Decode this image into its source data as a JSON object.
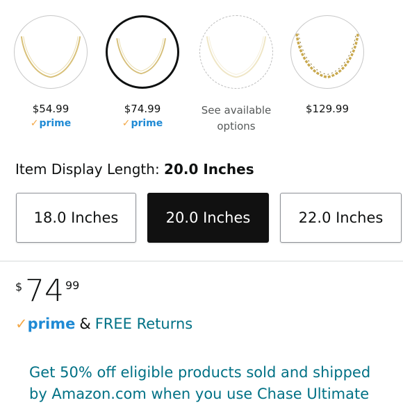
{
  "variants": [
    {
      "price": "$54.99",
      "prime": true,
      "state": "default"
    },
    {
      "price": "$74.99",
      "prime": true,
      "state": "selected"
    },
    {
      "note_line1": "See available",
      "note_line2": "options",
      "prime": false,
      "state": "unavailable"
    },
    {
      "price": "$129.99",
      "prime": false,
      "state": "default"
    }
  ],
  "prime_label": "prime",
  "length_selector": {
    "label": "Item Display Length:",
    "selected_value": "20.0 Inches",
    "options": [
      "18.0 Inches",
      "20.0 Inches",
      "22.0 Inches"
    ]
  },
  "price": {
    "symbol": "$",
    "whole": "74",
    "fraction": "99"
  },
  "shipping": {
    "prime": "prime",
    "connector": "&",
    "returns": "FREE Returns"
  },
  "promo": {
    "line1": "Get 50% off eligible products sold and shipped",
    "line2": "by Amazon.com when you use Chase Ultimate"
  },
  "colors": {
    "accent_prime": "#1f8ad4",
    "prime_check": "#f3a847",
    "link": "#007185",
    "selected_button": "#111111"
  }
}
